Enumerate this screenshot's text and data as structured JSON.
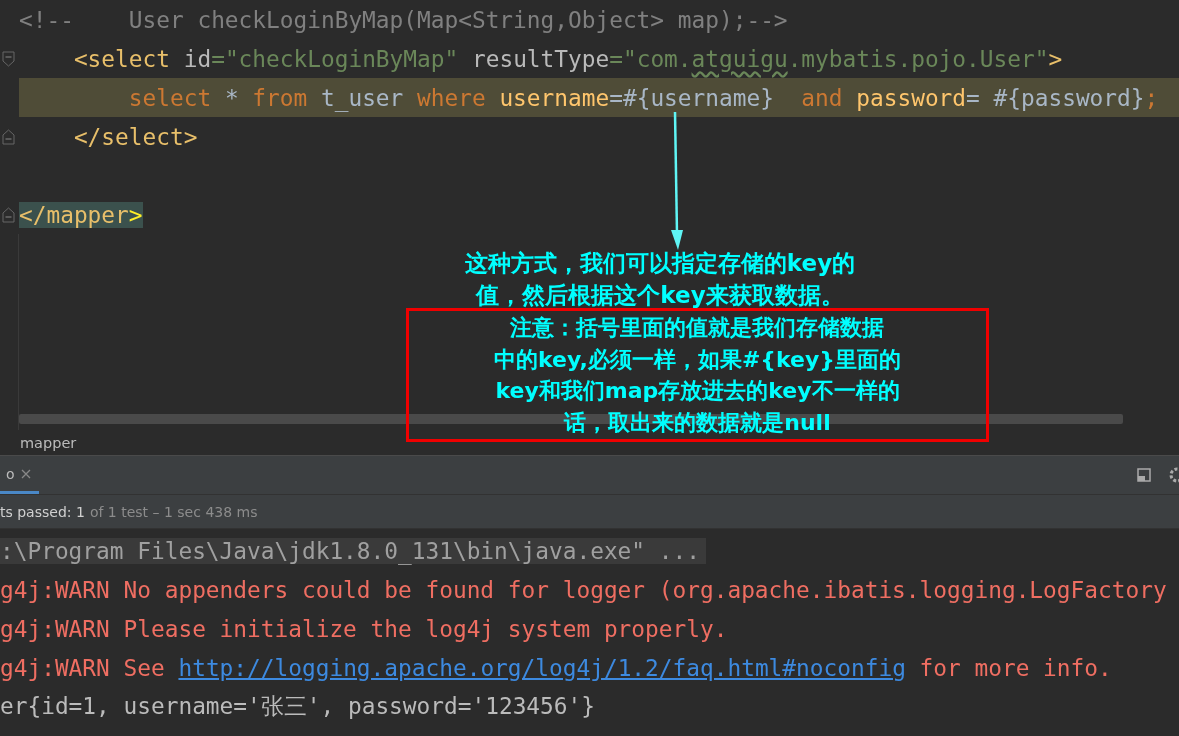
{
  "editor": {
    "lines": [
      {
        "fold_start": false,
        "fold_end": false,
        "highlight": false,
        "tokens": [
          {
            "text": "<!--    User checkLoginByMap(Map<String,Object> map);-->",
            "kind": "comment"
          }
        ]
      },
      {
        "fold_start": true,
        "fold_end": false,
        "highlight": false,
        "tokens": [
          {
            "text": "    <select ",
            "kind": "tag"
          },
          {
            "text": "id",
            "kind": "attr"
          },
          {
            "text": "=",
            "kind": "string"
          },
          {
            "text": "\"checkLoginByMap\" ",
            "kind": "string"
          },
          {
            "text": "resultType",
            "kind": "attr"
          },
          {
            "text": "=\"com.",
            "kind": "string"
          },
          {
            "text": "atguigu",
            "kind": "string",
            "typo": true
          },
          {
            "text": ".mybatis.pojo.User\"",
            "kind": "string"
          },
          {
            "text": ">",
            "kind": "tag"
          }
        ]
      },
      {
        "fold_start": false,
        "fold_end": false,
        "highlight": true,
        "tokens": [
          {
            "text": "        select ",
            "kind": "keyword"
          },
          {
            "text": "* ",
            "kind": "plain"
          },
          {
            "text": "from ",
            "kind": "keyword"
          },
          {
            "text": "t_user ",
            "kind": "plain"
          },
          {
            "text": "where ",
            "kind": "keyword"
          },
          {
            "text": "username",
            "kind": "column"
          },
          {
            "text": "=#{username}  ",
            "kind": "plain"
          },
          {
            "text": "and ",
            "kind": "keyword"
          },
          {
            "text": "password",
            "kind": "column"
          },
          {
            "text": "= #{password}",
            "kind": "plain"
          },
          {
            "text": ";",
            "kind": "keyword"
          }
        ]
      },
      {
        "fold_start": false,
        "fold_end": true,
        "highlight": false,
        "tokens": [
          {
            "text": "    </select>",
            "kind": "tag"
          }
        ]
      },
      {
        "fold_start": false,
        "fold_end": false,
        "highlight": false
      },
      {
        "fold_start": false,
        "fold_end": true,
        "highlight": false,
        "tokens": [
          {
            "text": "</mapper",
            "kind": "tag",
            "matched": true
          },
          {
            "text": ">",
            "kind": "bracket",
            "matched": true
          }
        ]
      }
    ]
  },
  "breadcrumb": "mapper",
  "run_panel": {
    "tab": "o",
    "status": {
      "passed": "ts passed: 1",
      "detail": "of 1 test – 1 sec 438 ms"
    },
    "console": [
      [
        {
          "text": ":\\Program Files\\Java\\jdk1.8.0_131\\bin\\java.exe\" ...",
          "kind": "command"
        }
      ],
      [
        {
          "text": "g4j:WARN No appenders could be found for logger (org.apache.ibatis.logging.LogFactory",
          "kind": "warn"
        }
      ],
      [
        {
          "text": "g4j:WARN Please initialize the log4j system properly.",
          "kind": "warn"
        }
      ],
      [
        {
          "text": "g4j:WARN See ",
          "kind": "warn"
        },
        {
          "text": "http://logging.apache.org/log4j/1.2/faq.html#noconfig",
          "kind": "link"
        },
        {
          "text": " for more info.",
          "kind": "warn"
        }
      ],
      [
        {
          "text": "er{id=1, username='张三', password='123456'}",
          "kind": "output"
        }
      ]
    ]
  },
  "annotation": {
    "note_lines": [
      "这种方式，我们可以指定存储的key的",
      "值，然后根据这个key来获取数据。"
    ],
    "boxed_note_lines": [
      "注意：括号里面的值就是我们存储数据",
      "中的key,必须一样，如果#{key}里面的",
      "key和我们map存放进去的key不一样的",
      "话，取出来的数据就是null"
    ]
  }
}
